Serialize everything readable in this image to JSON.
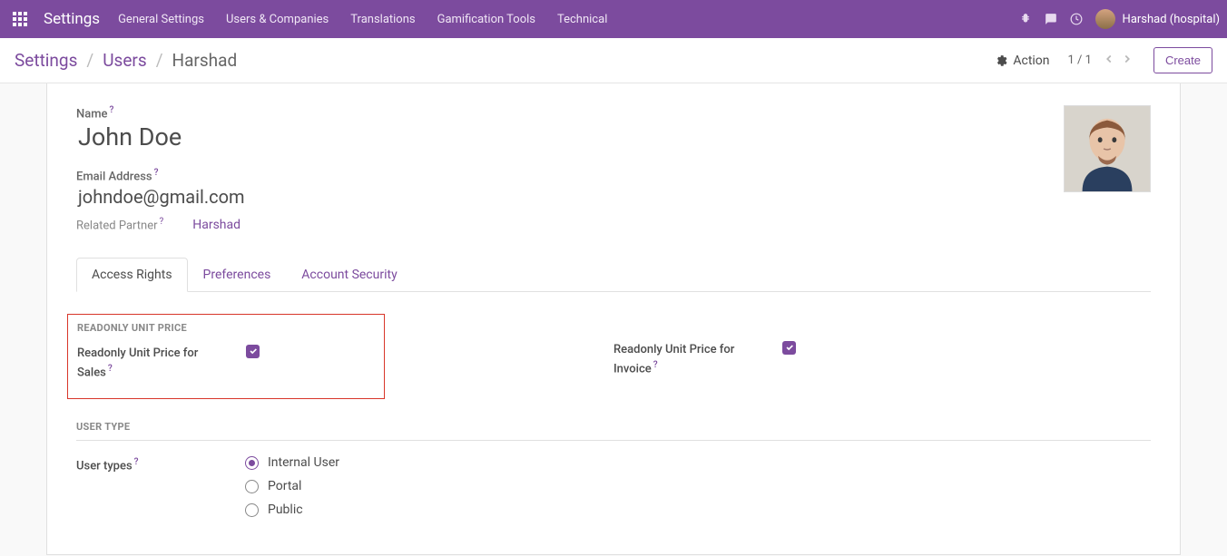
{
  "nav": {
    "app_title": "Settings",
    "items": [
      "General Settings",
      "Users & Companies",
      "Translations",
      "Gamification Tools",
      "Technical"
    ],
    "user_label": "Harshad (hospital)"
  },
  "breadcrumbs": {
    "root": "Settings",
    "mid": "Users",
    "current": "Harshad"
  },
  "controls": {
    "action_label": "Action",
    "pager": "1 / 1",
    "create_label": "Create"
  },
  "form": {
    "name_label": "Name",
    "name_value": "John Doe",
    "email_label": "Email Address",
    "email_value": "johndoe@gmail.com",
    "related_label": "Related Partner",
    "related_value": "Harshad",
    "help": "?"
  },
  "tabs": [
    "Access Rights",
    "Preferences",
    "Account Security"
  ],
  "sections": {
    "readonly_title": "READONLY UNIT PRICE",
    "readonly_sales_label": "Readonly Unit Price for Sales",
    "readonly_invoice_label": "Readonly Unit Price for Invoice",
    "usertype_title": "USER TYPE",
    "usertypes_label": "User types",
    "usertypes_options": [
      "Internal User",
      "Portal",
      "Public"
    ]
  }
}
